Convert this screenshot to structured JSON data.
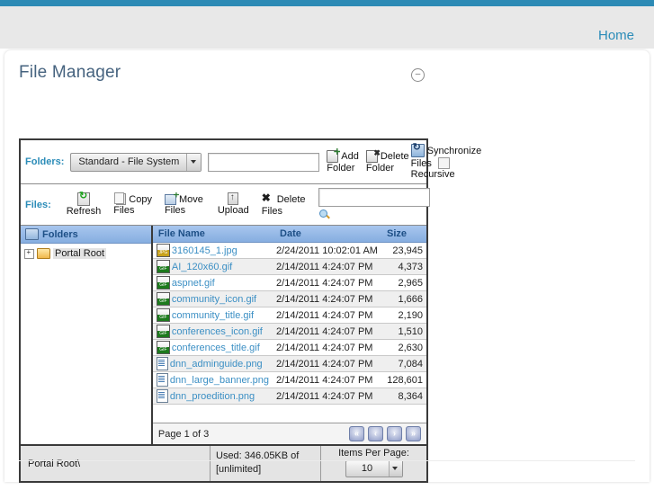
{
  "top_nav": {
    "home_label": "Home"
  },
  "module": {
    "title": "File Manager",
    "collapse_icon": "collapse-icon"
  },
  "toolbar": {
    "folders_label": "Folders:",
    "folder_provider_value": "Standard - File System",
    "new_folder_placeholder": "",
    "new_folder_value": "",
    "add_folder_line1": "Add",
    "add_folder_line2": "Folder",
    "delete_folder_line1": "Delete",
    "delete_folder_line2": "Folder",
    "sync_line1": "Synchronize",
    "sync_line2": "Files",
    "sync_line3": "Recursive",
    "files_label": "Files:",
    "refresh_line1": "",
    "refresh_line2": "Refresh",
    "copy_line1": "Copy",
    "copy_line2": "Files",
    "move_line1": "Move",
    "move_line2": "Files",
    "upload_line1": "",
    "upload_line2": "Upload",
    "delete_files_line1": "Delete",
    "delete_files_line2": "Files",
    "search_value": "",
    "search_placeholder": ""
  },
  "tree": {
    "panel_title": "Folders",
    "root_label": "Portal Root"
  },
  "filelist": {
    "columns": [
      "File Name",
      "Date",
      "Size"
    ],
    "rows": [
      {
        "name": "3160145_1.jpg",
        "date": "2/24/2011 10:02:01 AM",
        "size": "23,945",
        "kind": "jpg"
      },
      {
        "name": "AI_120x60.gif",
        "date": "2/14/2011 4:24:07 PM",
        "size": "4,373",
        "kind": "gif"
      },
      {
        "name": "aspnet.gif",
        "date": "2/14/2011 4:24:07 PM",
        "size": "2,965",
        "kind": "gif"
      },
      {
        "name": "community_icon.gif",
        "date": "2/14/2011 4:24:07 PM",
        "size": "1,666",
        "kind": "gif"
      },
      {
        "name": "community_title.gif",
        "date": "2/14/2011 4:24:07 PM",
        "size": "2,190",
        "kind": "gif"
      },
      {
        "name": "conferences_icon.gif",
        "date": "2/14/2011 4:24:07 PM",
        "size": "1,510",
        "kind": "gif"
      },
      {
        "name": "conferences_title.gif",
        "date": "2/14/2011 4:24:07 PM",
        "size": "2,630",
        "kind": "gif"
      },
      {
        "name": "dnn_adminguide.png",
        "date": "2/14/2011 4:24:07 PM",
        "size": "7,084",
        "kind": "png"
      },
      {
        "name": "dnn_large_banner.png",
        "date": "2/14/2011 4:24:07 PM",
        "size": "128,601",
        "kind": "png"
      },
      {
        "name": "dnn_proedition.png",
        "date": "2/14/2011 4:24:07 PM",
        "size": "8,364",
        "kind": "png"
      }
    ]
  },
  "pager": {
    "page_text": "Page 1 of 3",
    "first_glyph": "«",
    "prev_glyph": "‹",
    "next_glyph": "›",
    "last_glyph": "»"
  },
  "status": {
    "path": "Portal Root\\",
    "used_line1": "Used: 346.05KB of",
    "used_line2": "[unlimited]",
    "items_per_page_label": "Items Per Page:",
    "items_per_page_value": "10"
  },
  "colors": {
    "accent": "#2c8ab5",
    "link": "#3b8fc4",
    "title": "#46637f",
    "panel_header": "#86aee0"
  }
}
